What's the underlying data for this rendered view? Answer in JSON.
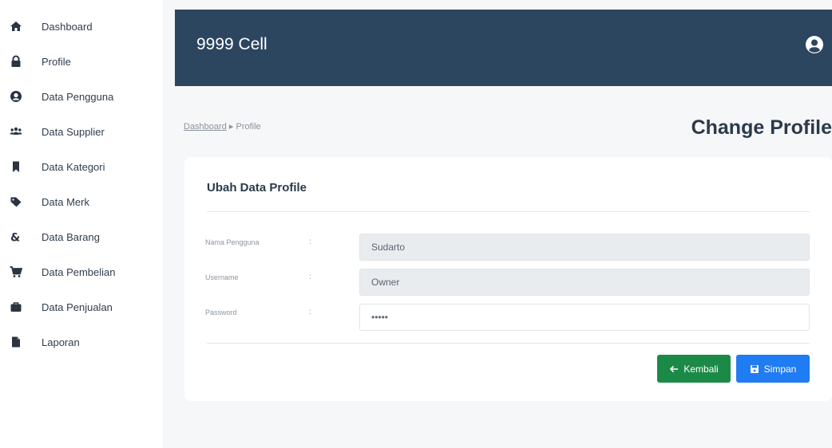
{
  "sidebar": {
    "items": [
      {
        "label": "Dashboard",
        "icon": "home-icon"
      },
      {
        "label": "Profile",
        "icon": "lock-icon"
      },
      {
        "label": "Data Pengguna",
        "icon": "user-circle-icon"
      },
      {
        "label": "Data Supplier",
        "icon": "users-icon"
      },
      {
        "label": "Data Kategori",
        "icon": "bookmark-icon"
      },
      {
        "label": "Data Merk",
        "icon": "tag-icon"
      },
      {
        "label": "Data Barang",
        "icon": "ampersand-icon"
      },
      {
        "label": "Data Pembelian",
        "icon": "cart-icon"
      },
      {
        "label": "Data Penjualan",
        "icon": "briefcase-icon"
      },
      {
        "label": "Laporan",
        "icon": "file-icon"
      }
    ]
  },
  "header": {
    "title": "9999 Cell",
    "user_icon": "user-circle-icon"
  },
  "breadcrumb": {
    "link": "Dashboard",
    "separator": "▸",
    "current": "Profile"
  },
  "page_title": "Change Profile",
  "card": {
    "title": "Ubah Data Profile",
    "fields": [
      {
        "label": "Nama Pengguna",
        "colon": ":",
        "value": "Sudarto"
      },
      {
        "label": "Username",
        "colon": ":",
        "value": "Owner"
      },
      {
        "label": "Password",
        "colon": ":",
        "value": "•••••"
      }
    ],
    "back_button": "Kembali",
    "save_button": "Simpan"
  },
  "colors": {
    "topbar": "#2c4660",
    "back_button": "#1c8a47",
    "save_button": "#1f7cf2"
  }
}
